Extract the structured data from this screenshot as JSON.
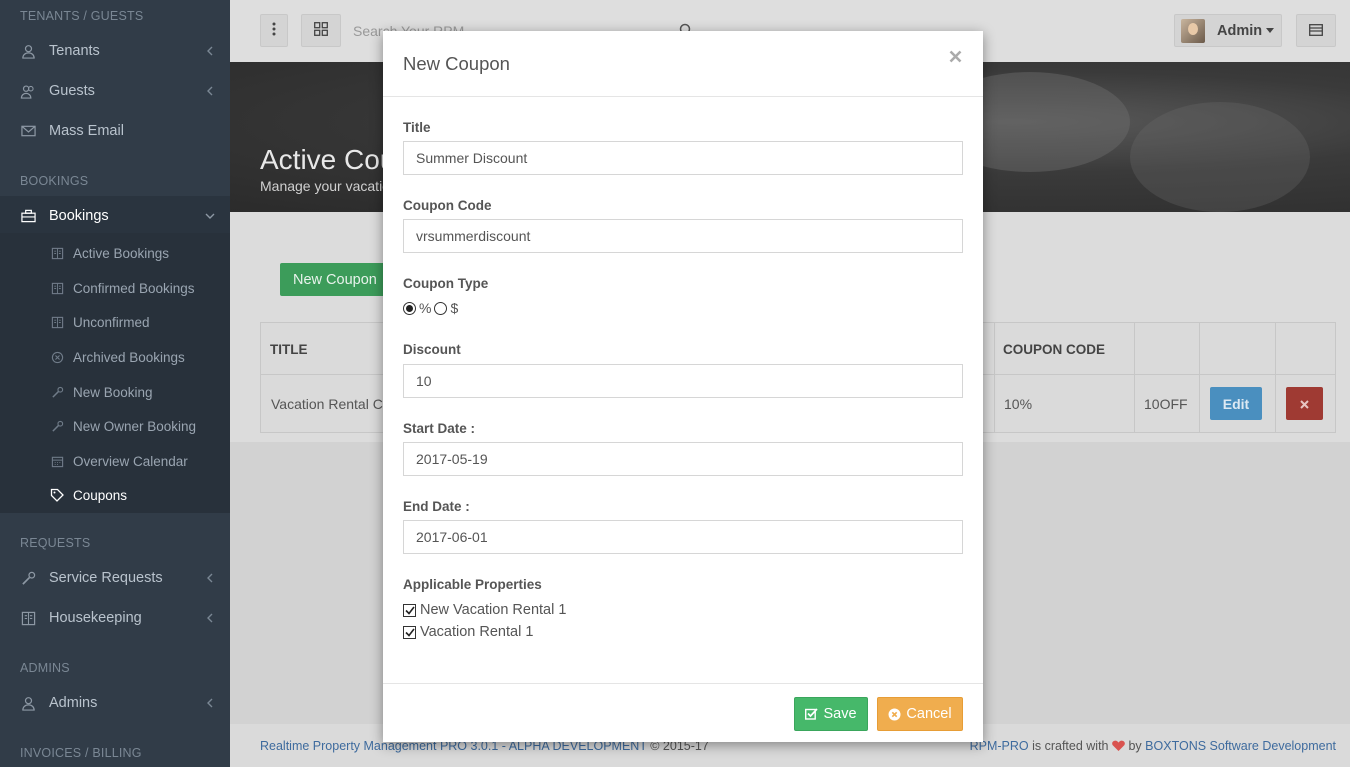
{
  "sidebar": {
    "sections": {
      "tenants_guests": "TENANTS / GUESTS",
      "bookings": "BOOKINGS",
      "requests": "REQUESTS",
      "admins": "ADMINS",
      "invoices_billing": "INVOICES / BILLING"
    },
    "items": {
      "tenants": "Tenants",
      "guests": "Guests",
      "mass_email": "Mass Email",
      "bookings": "Bookings",
      "service_requests": "Service Requests",
      "housekeeping": "Housekeeping",
      "admins": "Admins"
    },
    "sub_items": {
      "active_bookings": "Active Bookings",
      "confirmed_bookings": "Confirmed Bookings",
      "unconfirmed": "Unconfirmed",
      "archived_bookings": "Archived Bookings",
      "new_booking": "New Booking",
      "new_owner_booking": "New Owner Booking",
      "overview_calendar": "Overview Calendar",
      "coupons": "Coupons"
    }
  },
  "header": {
    "search_placeholder": "Search Your RPM...",
    "user_name": "Admin"
  },
  "hero": {
    "title": "Active Coupons",
    "subtitle": "Manage your vacation rental coupons"
  },
  "content": {
    "new_coupon_button": "New Coupon",
    "table": {
      "columns": [
        "TITLE",
        "COUPON CODE"
      ],
      "rows": [
        {
          "title": "Vacation Rental Coupon",
          "discount": "10%",
          "code": "10OFF",
          "edit": "Edit"
        }
      ]
    }
  },
  "modal": {
    "title": "New Coupon",
    "fields": {
      "title_label": "Title",
      "title_value": "Summer Discount",
      "code_label": "Coupon Code",
      "code_value": "vrsummerdiscount",
      "type_label": "Coupon Type",
      "type_percent": "%",
      "type_dollar": "$",
      "type_selected": "%",
      "discount_label": "Discount",
      "discount_value": "10",
      "start_label": "Start Date :",
      "start_value": "2017-05-19",
      "end_label": "End Date :",
      "end_value": "2017-06-01",
      "properties_label": "Applicable Properties",
      "properties": [
        {
          "name": "New Vacation Rental 1",
          "checked": true
        },
        {
          "name": "Vacation Rental 1",
          "checked": true
        }
      ]
    },
    "save_label": "Save",
    "cancel_label": "Cancel"
  },
  "footer": {
    "product": "Realtime Property Management PRO 3.0.1 - ALPHA DEVELOPMENT",
    "copyright": "© 2015-17",
    "brand": "RPM-PRO",
    "crafted": "is crafted with",
    "by": "by",
    "company": "BOXTONS Software Development"
  },
  "colors": {
    "sidebar_bg": "#313c48",
    "accent_green": "#46b86a",
    "accent_orange": "#f0ad4e",
    "edit_blue": "#4a8fbf",
    "delete_red": "#9f3a33",
    "heart_red": "#d9534f"
  }
}
